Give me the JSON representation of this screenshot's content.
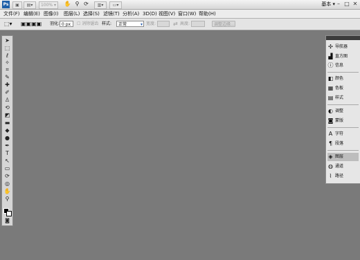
{
  "app": {
    "logo": "Ps",
    "zoom_value": "100%",
    "workspace": "基本",
    "workspace_arrow": "▾",
    "minimize_glyph": "–",
    "maximize_glyph": "□",
    "close_glyph": "✕"
  },
  "menu": {
    "items": [
      "文件(F)",
      "编辑(E)",
      "图像(I)",
      "图层(L)",
      "选择(S)",
      "滤镜(T)",
      "分析(A)",
      "3D(D)",
      "视图(V)",
      "窗口(W)",
      "帮助(H)"
    ]
  },
  "options": {
    "feather_label": "羽化:",
    "feather_value": "0 px",
    "antialias_label": "消除锯齿",
    "style_label": "样式:",
    "style_value": "正常",
    "width_label": "宽度:",
    "height_label": "高度:",
    "refine_edge_label": "调整边缘..."
  },
  "panels": {
    "items": [
      {
        "label": "导航器",
        "icon": "navigator-icon",
        "glyph": "✣"
      },
      {
        "label": "直方图",
        "icon": "histogram-icon",
        "glyph": "▟"
      },
      {
        "label": "信息",
        "icon": "info-icon",
        "glyph": "ⓘ"
      },
      {
        "label": "颜色",
        "icon": "color-icon",
        "glyph": "◧"
      },
      {
        "label": "色板",
        "icon": "swatches-icon",
        "glyph": "▦"
      },
      {
        "label": "样式",
        "icon": "styles-icon",
        "glyph": "▤"
      },
      {
        "label": "调整",
        "icon": "adjustments-icon",
        "glyph": "◐"
      },
      {
        "label": "蒙版",
        "icon": "masks-icon",
        "glyph": "◙"
      },
      {
        "label": "字符",
        "icon": "character-icon",
        "glyph": "A"
      },
      {
        "label": "段落",
        "icon": "paragraph-icon",
        "glyph": "¶"
      },
      {
        "label": "图层",
        "icon": "layers-icon",
        "glyph": "◈"
      },
      {
        "label": "通道",
        "icon": "channels-icon",
        "glyph": "◍"
      },
      {
        "label": "路径",
        "icon": "paths-icon",
        "glyph": "⌇"
      }
    ]
  },
  "tools": [
    {
      "name": "move-tool-icon",
      "glyph": "➤"
    },
    {
      "name": "marquee-tool-icon",
      "glyph": "⬚"
    },
    {
      "name": "lasso-tool-icon",
      "glyph": "ℓ"
    },
    {
      "name": "quick-selection-tool-icon",
      "glyph": "✧"
    },
    {
      "name": "crop-tool-icon",
      "glyph": "⌗"
    },
    {
      "name": "eyedropper-tool-icon",
      "glyph": "✎"
    },
    {
      "name": "healing-brush-tool-icon",
      "glyph": "✚"
    },
    {
      "name": "brush-tool-icon",
      "glyph": "✐"
    },
    {
      "name": "clone-stamp-tool-icon",
      "glyph": "♙"
    },
    {
      "name": "history-brush-tool-icon",
      "glyph": "⟲"
    },
    {
      "name": "eraser-tool-icon",
      "glyph": "◩"
    },
    {
      "name": "gradient-tool-icon",
      "glyph": "▬"
    },
    {
      "name": "blur-tool-icon",
      "glyph": "◆"
    },
    {
      "name": "dodge-tool-icon",
      "glyph": "●"
    },
    {
      "name": "pen-tool-icon",
      "glyph": "✒"
    },
    {
      "name": "type-tool-icon",
      "glyph": "T"
    },
    {
      "name": "path-selection-tool-icon",
      "glyph": "↖"
    },
    {
      "name": "shape-tool-icon",
      "glyph": "▭"
    },
    {
      "name": "3d-rotate-tool-icon",
      "glyph": "⟳"
    },
    {
      "name": "3d-orbit-tool-icon",
      "glyph": "◎"
    },
    {
      "name": "hand-tool-icon",
      "glyph": "✋"
    },
    {
      "name": "zoom-tool-icon",
      "glyph": "⚲"
    }
  ]
}
